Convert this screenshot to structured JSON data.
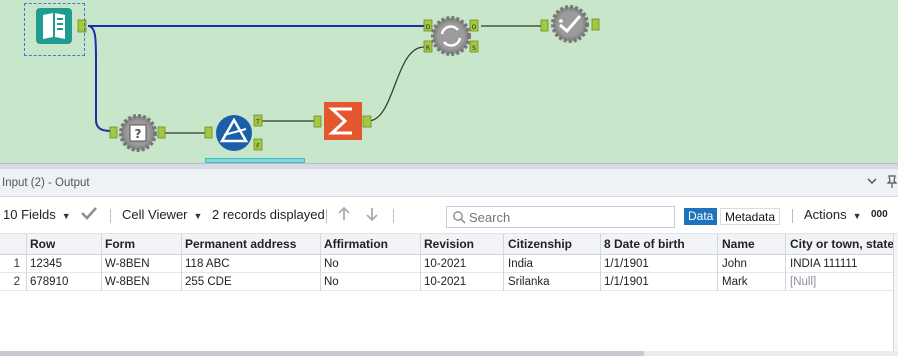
{
  "canvas": {
    "anchors": {
      "d": "D",
      "r": "R",
      "o": "O",
      "s": "S",
      "t": "T",
      "f": "F"
    }
  },
  "results": {
    "title": "Input (2) - Output",
    "chevron_icon": "chevron-down-icon",
    "pin_icon": "pin-icon"
  },
  "toolbar": {
    "fields": "10 Fields",
    "viewer": "Cell Viewer",
    "records": "2 records displayed",
    "search_placeholder": "Search",
    "data_tab": "Data",
    "metadata_tab": "Metadata",
    "actions": "Actions",
    "more": "000"
  },
  "table": {
    "columns": [
      "Row",
      "Form",
      "Permanent address",
      "Affirmation",
      "Revision",
      "Citizenship",
      "8 Date of birth",
      "Name",
      "City or town, state o"
    ],
    "rows": [
      {
        "num": "1",
        "cells": [
          "12345",
          "W-8BEN",
          "118 ABC",
          "No",
          "10-2021",
          "India",
          "1/1/1901",
          "John",
          "INDIA 111111"
        ]
      },
      {
        "num": "2",
        "cells": [
          "678910",
          "W-8BEN",
          "255 CDE",
          "No",
          "10-2021",
          "Srilanka",
          "1/1/1901",
          "Mark",
          "[Null]"
        ]
      }
    ]
  },
  "colors": {
    "canvas_bg": "#c8e6c9",
    "accent": "#1e73be",
    "null_text": "#8a8fa6"
  }
}
